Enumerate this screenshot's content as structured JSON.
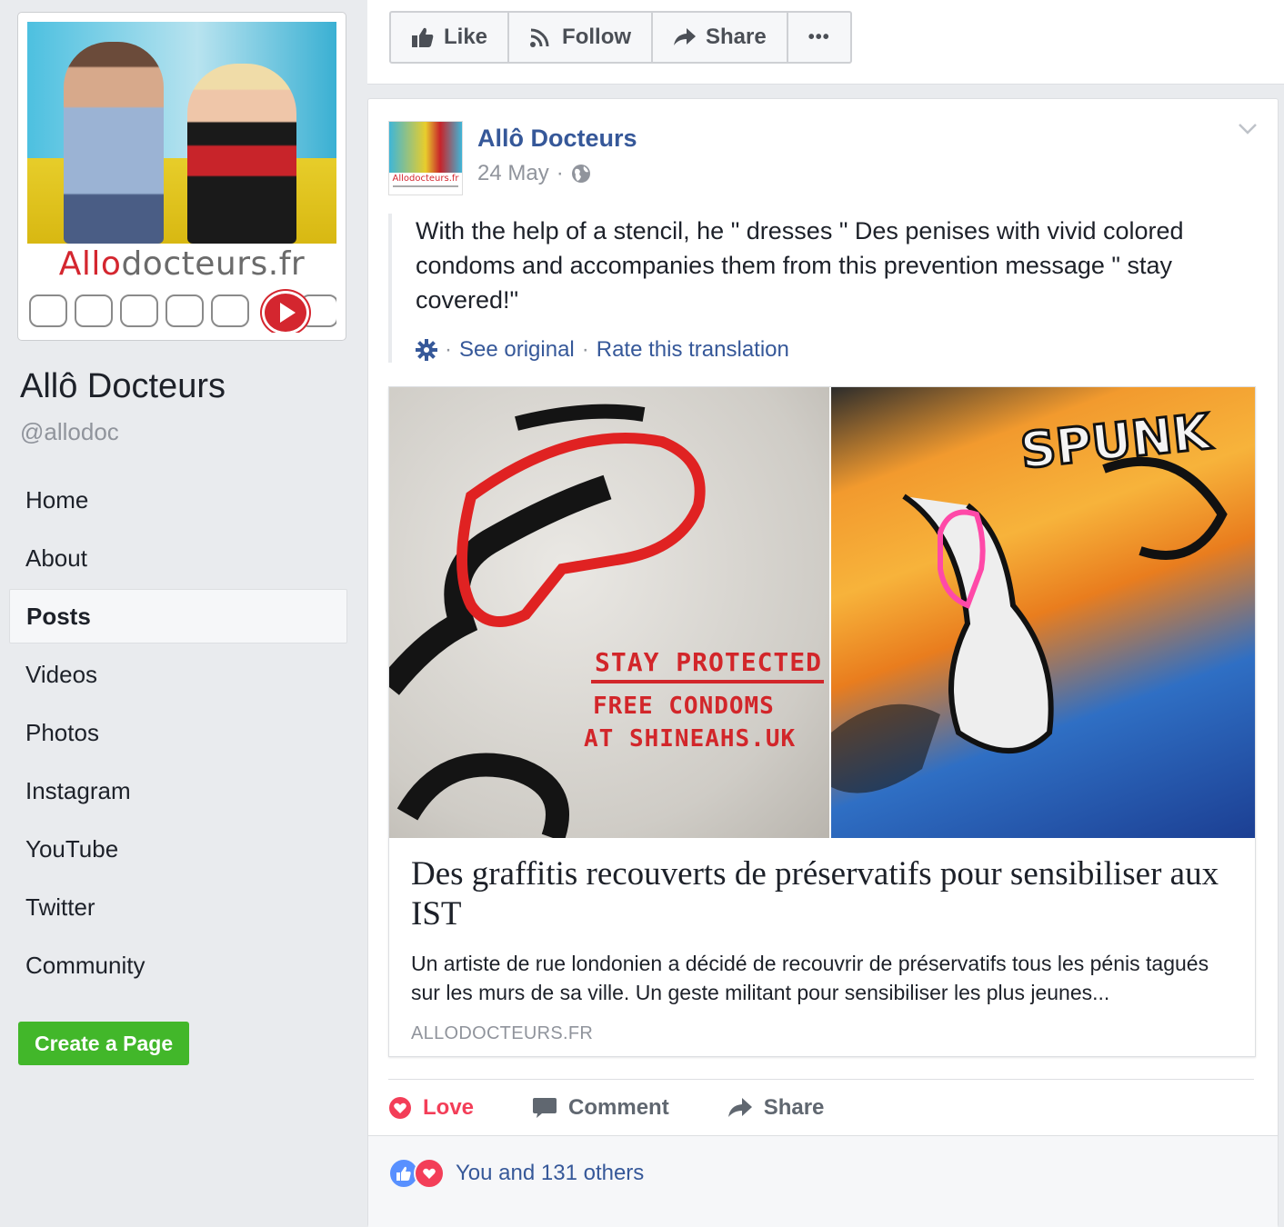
{
  "page": {
    "name": "Allô Docteurs",
    "handle": "@allodoc",
    "logo": {
      "part1": "Allo",
      "part2": "docteurs",
      "part3": ".fr"
    }
  },
  "nav": {
    "items": [
      {
        "label": "Home",
        "active": false
      },
      {
        "label": "About",
        "active": false
      },
      {
        "label": "Posts",
        "active": true
      },
      {
        "label": "Videos",
        "active": false
      },
      {
        "label": "Photos",
        "active": false
      },
      {
        "label": "Instagram",
        "active": false
      },
      {
        "label": "YouTube",
        "active": false
      },
      {
        "label": "Twitter",
        "active": false
      },
      {
        "label": "Community",
        "active": false
      }
    ],
    "create_page": "Create a Page"
  },
  "topbar": {
    "like": "Like",
    "follow": "Follow",
    "share": "Share",
    "more": "•••"
  },
  "post": {
    "author": "Allô Docteurs",
    "avatar_logo": "Allodocteurs.fr",
    "date": "24 May",
    "audience_icon": "globe-icon",
    "text": "With the help of a stencil, he \" dresses \" Des penises with vivid colored condoms and accompanies them from this prevention message \" stay covered!\"",
    "see_original": "See original",
    "rate_translation": "Rate this translation",
    "link": {
      "title": "Des graffitis recouverts de préservatifs pour sensibiliser aux IST",
      "description": "Un artiste de rue londonien a décidé de recouvrir de préservatifs tous les pénis tagués sur les murs de sa ville. Un geste militant pour sensibiliser les plus jeunes...",
      "domain": "ALLODOCTEURS.FR",
      "image_text_left": [
        "STAY PROTECTED",
        "FREE CONDOMS",
        "AT SHINEAHS.UK"
      ],
      "image_text_right": "SPUNK"
    },
    "actions": {
      "love": "Love",
      "comment": "Comment",
      "share": "Share"
    },
    "reactions_text": "You and 131 others"
  },
  "colors": {
    "link_blue": "#365899",
    "love_red": "#f33e58",
    "create_green": "#42b72a",
    "bg": "#e9ebee"
  }
}
